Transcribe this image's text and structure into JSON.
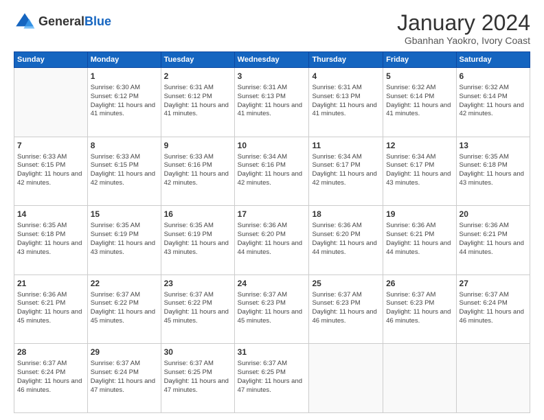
{
  "header": {
    "logo_general": "General",
    "logo_blue": "Blue",
    "month_title": "January 2024",
    "subtitle": "Gbanhan Yaokro, Ivory Coast"
  },
  "calendar": {
    "days_of_week": [
      "Sunday",
      "Monday",
      "Tuesday",
      "Wednesday",
      "Thursday",
      "Friday",
      "Saturday"
    ],
    "weeks": [
      [
        {
          "day": "",
          "sunrise": "",
          "sunset": "",
          "daylight": ""
        },
        {
          "day": "1",
          "sunrise": "Sunrise: 6:30 AM",
          "sunset": "Sunset: 6:12 PM",
          "daylight": "Daylight: 11 hours and 41 minutes."
        },
        {
          "day": "2",
          "sunrise": "Sunrise: 6:31 AM",
          "sunset": "Sunset: 6:12 PM",
          "daylight": "Daylight: 11 hours and 41 minutes."
        },
        {
          "day": "3",
          "sunrise": "Sunrise: 6:31 AM",
          "sunset": "Sunset: 6:13 PM",
          "daylight": "Daylight: 11 hours and 41 minutes."
        },
        {
          "day": "4",
          "sunrise": "Sunrise: 6:31 AM",
          "sunset": "Sunset: 6:13 PM",
          "daylight": "Daylight: 11 hours and 41 minutes."
        },
        {
          "day": "5",
          "sunrise": "Sunrise: 6:32 AM",
          "sunset": "Sunset: 6:14 PM",
          "daylight": "Daylight: 11 hours and 41 minutes."
        },
        {
          "day": "6",
          "sunrise": "Sunrise: 6:32 AM",
          "sunset": "Sunset: 6:14 PM",
          "daylight": "Daylight: 11 hours and 42 minutes."
        }
      ],
      [
        {
          "day": "7",
          "sunrise": "Sunrise: 6:33 AM",
          "sunset": "Sunset: 6:15 PM",
          "daylight": "Daylight: 11 hours and 42 minutes."
        },
        {
          "day": "8",
          "sunrise": "Sunrise: 6:33 AM",
          "sunset": "Sunset: 6:15 PM",
          "daylight": "Daylight: 11 hours and 42 minutes."
        },
        {
          "day": "9",
          "sunrise": "Sunrise: 6:33 AM",
          "sunset": "Sunset: 6:16 PM",
          "daylight": "Daylight: 11 hours and 42 minutes."
        },
        {
          "day": "10",
          "sunrise": "Sunrise: 6:34 AM",
          "sunset": "Sunset: 6:16 PM",
          "daylight": "Daylight: 11 hours and 42 minutes."
        },
        {
          "day": "11",
          "sunrise": "Sunrise: 6:34 AM",
          "sunset": "Sunset: 6:17 PM",
          "daylight": "Daylight: 11 hours and 42 minutes."
        },
        {
          "day": "12",
          "sunrise": "Sunrise: 6:34 AM",
          "sunset": "Sunset: 6:17 PM",
          "daylight": "Daylight: 11 hours and 43 minutes."
        },
        {
          "day": "13",
          "sunrise": "Sunrise: 6:35 AM",
          "sunset": "Sunset: 6:18 PM",
          "daylight": "Daylight: 11 hours and 43 minutes."
        }
      ],
      [
        {
          "day": "14",
          "sunrise": "Sunrise: 6:35 AM",
          "sunset": "Sunset: 6:18 PM",
          "daylight": "Daylight: 11 hours and 43 minutes."
        },
        {
          "day": "15",
          "sunrise": "Sunrise: 6:35 AM",
          "sunset": "Sunset: 6:19 PM",
          "daylight": "Daylight: 11 hours and 43 minutes."
        },
        {
          "day": "16",
          "sunrise": "Sunrise: 6:35 AM",
          "sunset": "Sunset: 6:19 PM",
          "daylight": "Daylight: 11 hours and 43 minutes."
        },
        {
          "day": "17",
          "sunrise": "Sunrise: 6:36 AM",
          "sunset": "Sunset: 6:20 PM",
          "daylight": "Daylight: 11 hours and 44 minutes."
        },
        {
          "day": "18",
          "sunrise": "Sunrise: 6:36 AM",
          "sunset": "Sunset: 6:20 PM",
          "daylight": "Daylight: 11 hours and 44 minutes."
        },
        {
          "day": "19",
          "sunrise": "Sunrise: 6:36 AM",
          "sunset": "Sunset: 6:21 PM",
          "daylight": "Daylight: 11 hours and 44 minutes."
        },
        {
          "day": "20",
          "sunrise": "Sunrise: 6:36 AM",
          "sunset": "Sunset: 6:21 PM",
          "daylight": "Daylight: 11 hours and 44 minutes."
        }
      ],
      [
        {
          "day": "21",
          "sunrise": "Sunrise: 6:36 AM",
          "sunset": "Sunset: 6:21 PM",
          "daylight": "Daylight: 11 hours and 45 minutes."
        },
        {
          "day": "22",
          "sunrise": "Sunrise: 6:37 AM",
          "sunset": "Sunset: 6:22 PM",
          "daylight": "Daylight: 11 hours and 45 minutes."
        },
        {
          "day": "23",
          "sunrise": "Sunrise: 6:37 AM",
          "sunset": "Sunset: 6:22 PM",
          "daylight": "Daylight: 11 hours and 45 minutes."
        },
        {
          "day": "24",
          "sunrise": "Sunrise: 6:37 AM",
          "sunset": "Sunset: 6:23 PM",
          "daylight": "Daylight: 11 hours and 45 minutes."
        },
        {
          "day": "25",
          "sunrise": "Sunrise: 6:37 AM",
          "sunset": "Sunset: 6:23 PM",
          "daylight": "Daylight: 11 hours and 46 minutes."
        },
        {
          "day": "26",
          "sunrise": "Sunrise: 6:37 AM",
          "sunset": "Sunset: 6:23 PM",
          "daylight": "Daylight: 11 hours and 46 minutes."
        },
        {
          "day": "27",
          "sunrise": "Sunrise: 6:37 AM",
          "sunset": "Sunset: 6:24 PM",
          "daylight": "Daylight: 11 hours and 46 minutes."
        }
      ],
      [
        {
          "day": "28",
          "sunrise": "Sunrise: 6:37 AM",
          "sunset": "Sunset: 6:24 PM",
          "daylight": "Daylight: 11 hours and 46 minutes."
        },
        {
          "day": "29",
          "sunrise": "Sunrise: 6:37 AM",
          "sunset": "Sunset: 6:24 PM",
          "daylight": "Daylight: 11 hours and 47 minutes."
        },
        {
          "day": "30",
          "sunrise": "Sunrise: 6:37 AM",
          "sunset": "Sunset: 6:25 PM",
          "daylight": "Daylight: 11 hours and 47 minutes."
        },
        {
          "day": "31",
          "sunrise": "Sunrise: 6:37 AM",
          "sunset": "Sunset: 6:25 PM",
          "daylight": "Daylight: 11 hours and 47 minutes."
        },
        {
          "day": "",
          "sunrise": "",
          "sunset": "",
          "daylight": ""
        },
        {
          "day": "",
          "sunrise": "",
          "sunset": "",
          "daylight": ""
        },
        {
          "day": "",
          "sunrise": "",
          "sunset": "",
          "daylight": ""
        }
      ]
    ]
  }
}
